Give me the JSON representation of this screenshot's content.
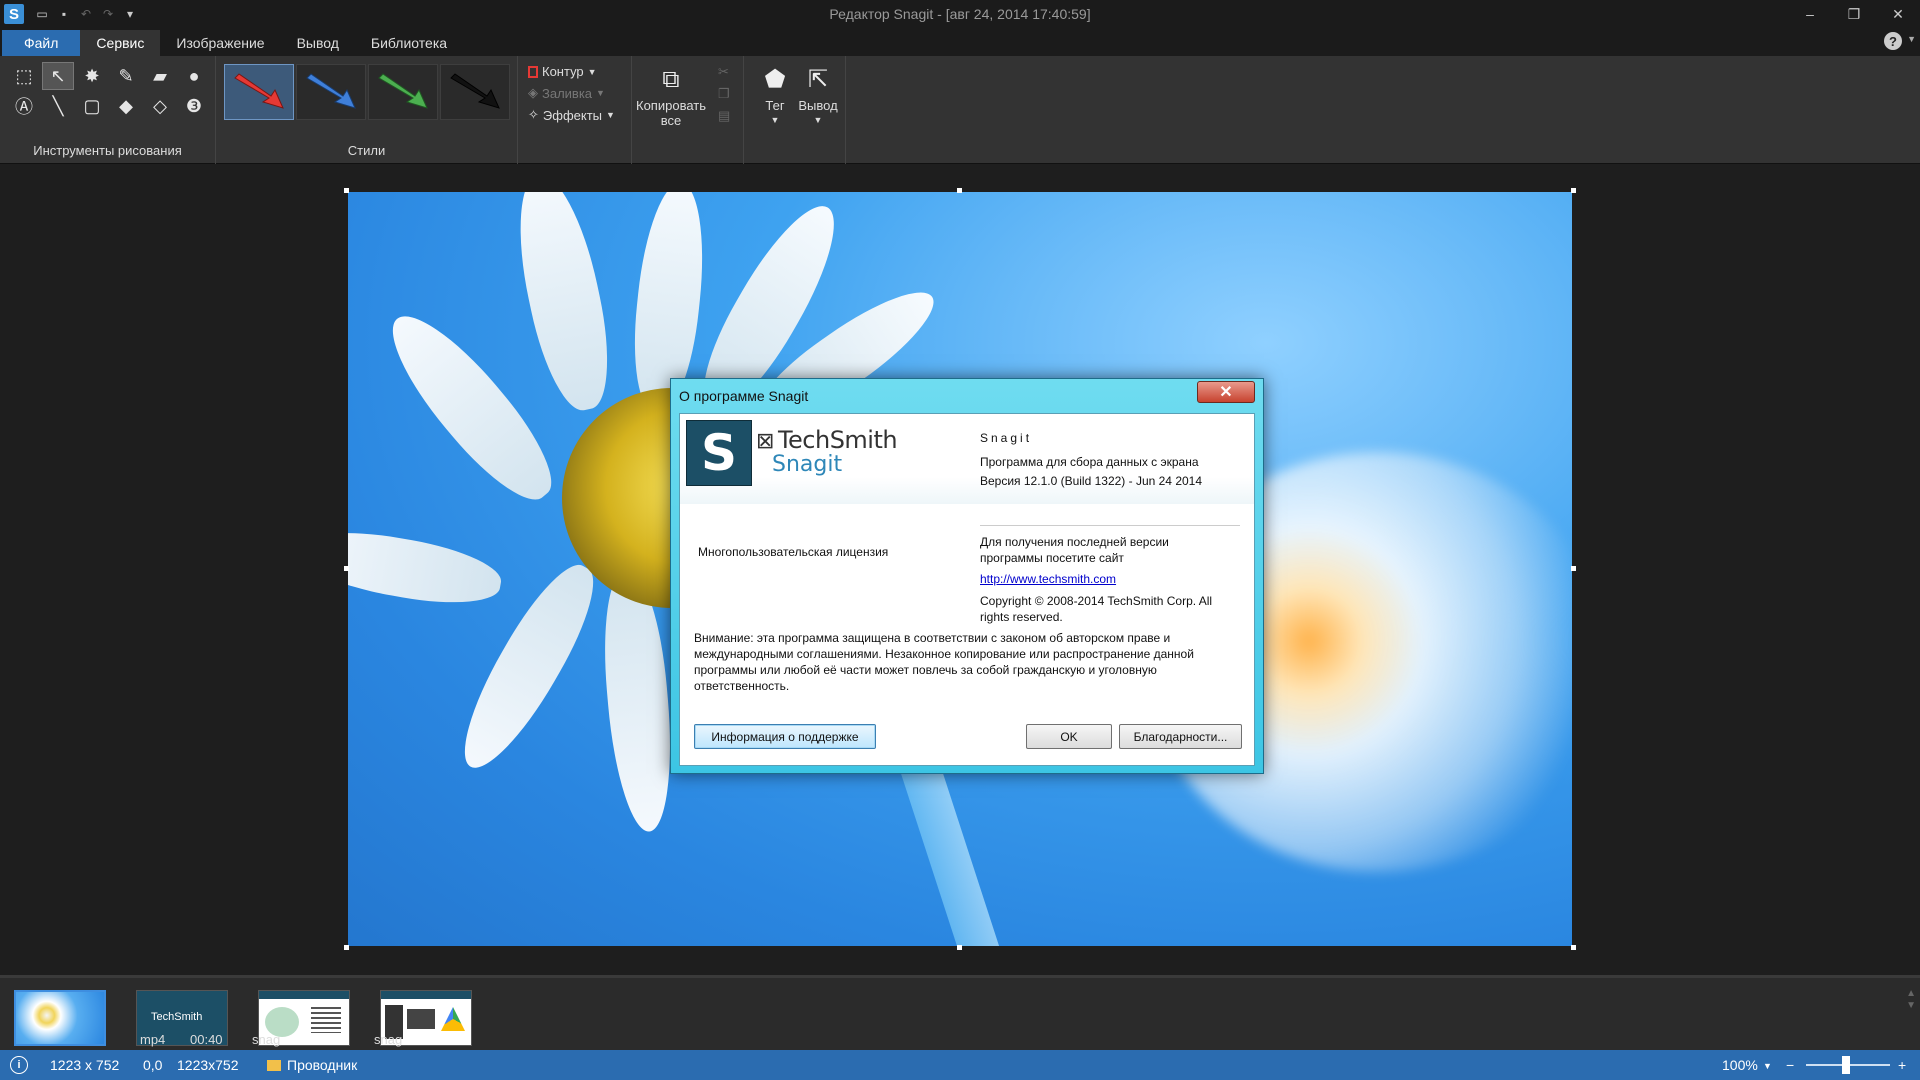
{
  "window": {
    "title": "Редактор Snagit - [авг 24, 2014 17:40:59]",
    "app_icon": "S",
    "minimize": "–",
    "restore": "❐",
    "close": "✕"
  },
  "menu": {
    "tabs": [
      "Файл",
      "Сервис",
      "Изображение",
      "Вывод",
      "Библиотека"
    ],
    "active_index": 1,
    "help": "?"
  },
  "ribbon": {
    "drawing_tools_label": "Инструменты рисования",
    "styles_label": "Стили",
    "style_colors": [
      "#e53935",
      "#3f7fd9",
      "#4caf50",
      "#111111"
    ],
    "outline_label": "Контур",
    "fill_label": "Заливка",
    "effects_label": "Эффекты",
    "copy_all_label_1": "Копировать",
    "copy_all_label_2": "все",
    "tag_label": "Тег",
    "output_label": "Вывод"
  },
  "dialog": {
    "title": "О программе Snagit",
    "brand": "TechSmith",
    "product": "Snagit",
    "product_name": "Snagit",
    "description": "Программа для сбора данных с экрана",
    "version": "Версия 12.1.0 (Build 1322) - Jun 24 2014",
    "license": "Многопользовательская лицензия",
    "latest_1": "Для получения последней версии",
    "latest_2": "программы посетите сайт",
    "url": "http://www.techsmith.com",
    "copyright_1": "Copyright © 2008-2014 TechSmith Corp. All",
    "copyright_2": "rights reserved.",
    "warning": "Внимание: эта программа защищена в соответствии с законом об авторском праве и международными соглашениями. Незаконное копирование или распространение данной программы или любой её части может повлечь за собой гражданскую и уголовную ответственность.",
    "support_button": "Информация о поддержке",
    "ok_button": "OK",
    "thanks_button": "Благодарности..."
  },
  "tray": {
    "items": [
      {
        "label": ""
      },
      {
        "label": "mp4",
        "duration": "00:40",
        "thumb_text": "TechSmith"
      },
      {
        "label": "snag"
      },
      {
        "label": "snag"
      }
    ]
  },
  "status": {
    "dimensions": "1223 x 752",
    "position": "0,0",
    "selection": "1223x752",
    "explorer": "Проводник",
    "zoom": "100%"
  }
}
